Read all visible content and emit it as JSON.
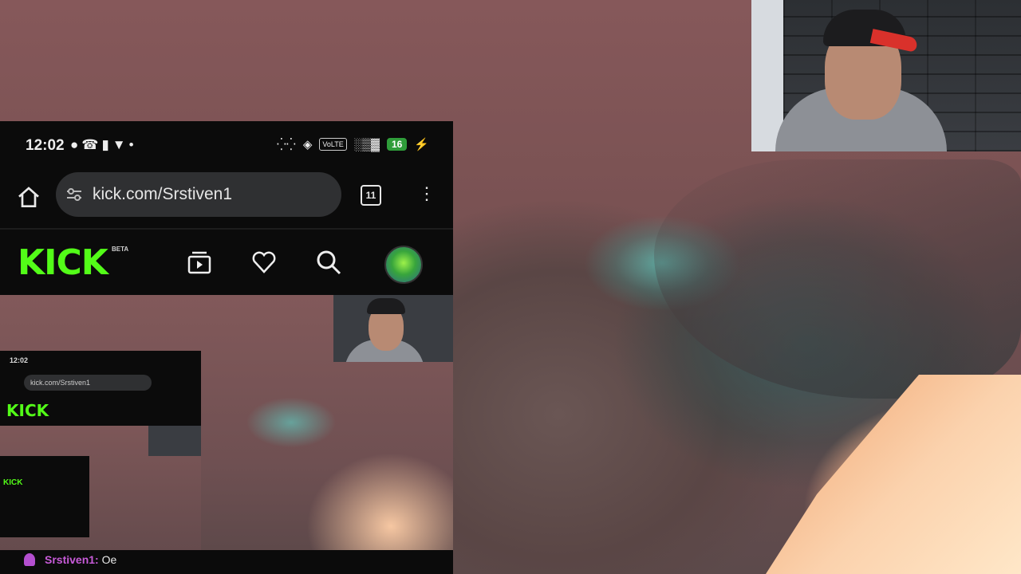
{
  "status_bar": {
    "time": "12:02",
    "left_icons": [
      "notification-icon",
      "whatsapp-icon",
      "app-icon",
      "shield-icon",
      "dot-icon"
    ],
    "volte_label": "VoLTE",
    "battery": "16",
    "right_icons": [
      "signal-icon",
      "wifi-icon",
      "volte-icon",
      "bars-icon",
      "battery-icon",
      "charging-icon"
    ]
  },
  "browser": {
    "url": "kick.com/Srstiven1",
    "tab_count": "11"
  },
  "kick": {
    "logo": "KICK",
    "beta_label": "BETA",
    "nav_icons": [
      "following-icon",
      "heart-icon",
      "search-icon",
      "avatar"
    ]
  },
  "nested": {
    "time": "12:02",
    "url": "kick.com/Srstiven1",
    "logo": "KICK"
  },
  "chat": {
    "username": "Srstiven1",
    "message": "Oe"
  },
  "colors": {
    "kick_green": "#53fc18",
    "chat_name": "#c85bd9",
    "battery": "#2f9d3a"
  }
}
